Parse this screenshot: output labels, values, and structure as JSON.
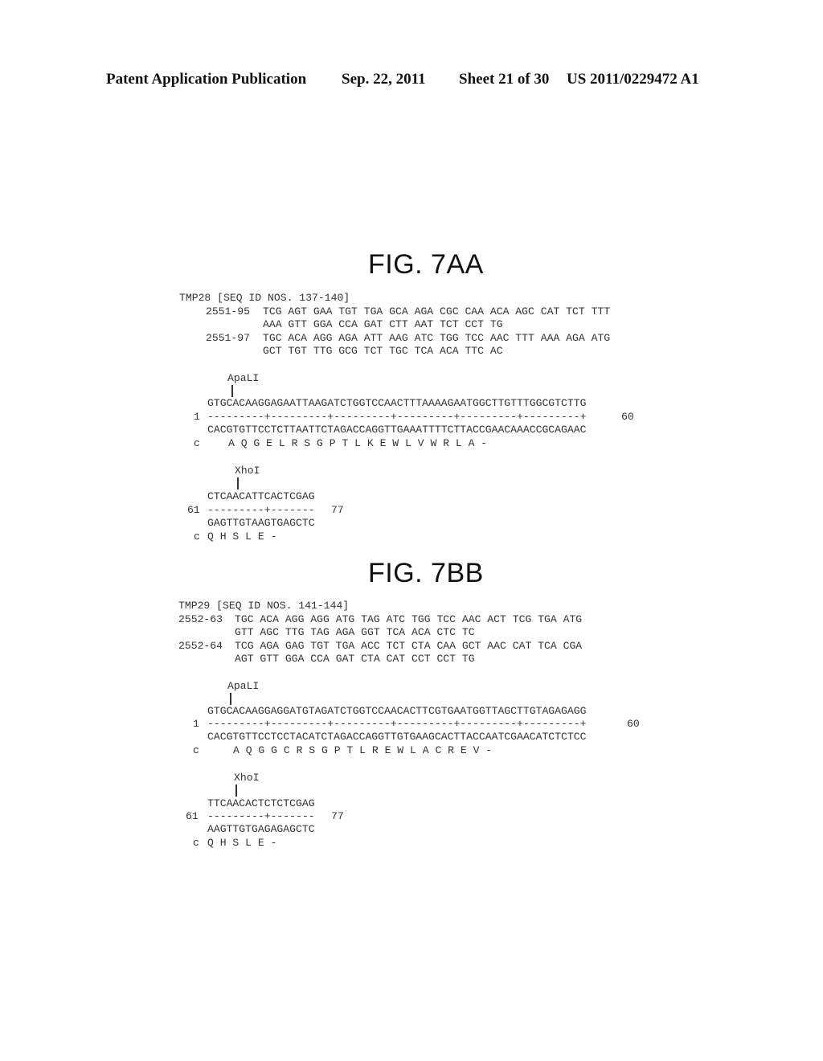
{
  "header": {
    "publication": "Patent Application Publication",
    "date": "Sep. 22, 2011",
    "sheet": "Sheet 21 of 30",
    "number": "US 2011/0229472 A1"
  },
  "figures": [
    {
      "title": "FIG. 7AA",
      "seq_header": "TMP28 [SEQ ID NOS. 137-140]",
      "oligos": [
        {
          "label": "2551-95",
          "line1": "TCG AGT GAA TGT TGA GCA AGA CGC CAA ACA AGC CAT TCT TTT",
          "line2": "AAA GTT GGA CCA GAT CTT AAT TCT CCT TG"
        },
        {
          "label": "2551-97",
          "line1": "TGC ACA AGG AGA ATT AAG ATC TGG TCC AAC TTT AAA AGA ATG",
          "line2": "GCT TGT TTG GCG TCT TGC TCA ACA TTC AC"
        }
      ],
      "block1": {
        "site": "ApaLI",
        "top": "GTGCACAAGGAGAATTAAGATCTGGTCCAACTTTAAAAGAATGGCTTGTTTGGCGTCTTG",
        "start": "1",
        "ruler": "---------+---------+---------+---------+---------+---------+",
        "end": "60",
        "bottom": "CACGTGTTCCTCTTAATTCTAGACCAGGTTGAAATTTTCTTACCGAACAAACCGCAGAAC",
        "frame": "c",
        "protein": "A Q G E L R S G P T L K E W L V W R L A -"
      },
      "block2": {
        "site": "XhoI",
        "top": "CTCAACATTCACTCGAG",
        "start": "61",
        "ruler": "---------+-------",
        "end": "77",
        "bottom": "GAGTTGTAAGTGAGCTC",
        "frame": "c",
        "protein": "Q H S L E -"
      }
    },
    {
      "title": "FIG. 7BB",
      "seq_header": "TMP29 [SEQ ID NOS. 141-144]",
      "oligos": [
        {
          "label": "2552-63",
          "line1": "TGC ACA AGG AGG ATG TAG ATC TGG TCC AAC ACT TCG TGA ATG",
          "line2": "GTT AGC TTG TAG AGA GGT TCA ACA CTC TC"
        },
        {
          "label": "2552-64",
          "line1": "TCG AGA GAG TGT TGA ACC TCT CTA CAA GCT AAC CAT TCA CGA",
          "line2": "AGT GTT GGA CCA GAT CTA CAT CCT CCT TG"
        }
      ],
      "block1": {
        "site": "ApaLI",
        "top": "GTGCACAAGGAGGATGTAGATCTGGTCCAACACTTCGTGAATGGTTAGCTTGTAGAGAGG",
        "start": "1",
        "ruler": "---------+---------+---------+---------+---------+---------+",
        "end": "60",
        "bottom": "CACGTGTTCCTCCTACATCTAGACCAGGTTGTGAAGCACTTACCAATCGAACATCTCTCC",
        "frame": "c",
        "protein": "A Q G G C R S G P T L R E W L A C R E V -"
      },
      "block2": {
        "site": "XhoI",
        "top": "TTCAACACTCTCTCGAG",
        "start": "61",
        "ruler": "---------+-------",
        "end": "77",
        "bottom": "AAGTTGTGAGAGAGCTC",
        "frame": "c",
        "protein": "Q H S L E -"
      }
    }
  ]
}
